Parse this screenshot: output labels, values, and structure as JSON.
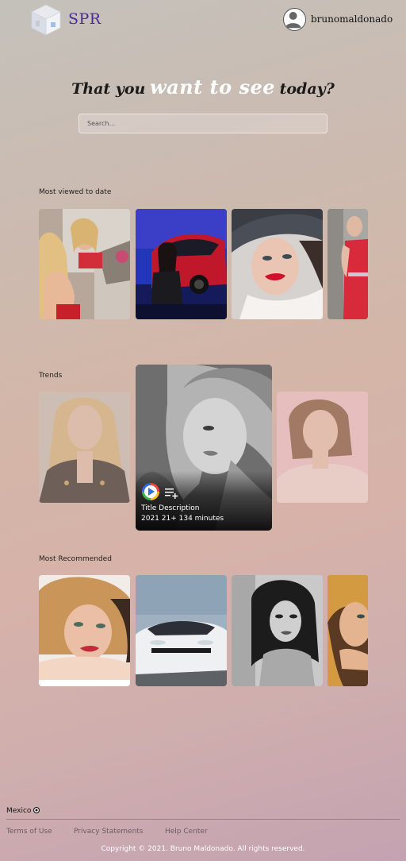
{
  "header": {
    "brand": "SPR",
    "username": "brunomaldonado"
  },
  "hero": {
    "part1": "That you",
    "part2": "want to see",
    "part3": "today?"
  },
  "search": {
    "placeholder": "Search..."
  },
  "sections": {
    "most_viewed": "Most viewed to date",
    "trends": "Trends",
    "most_recommended": "Most Recommended"
  },
  "featured": {
    "title": "Title Description",
    "meta": "2021 21+ 134 minutes",
    "play_icon": "play-icon",
    "list_icon": "add-to-list-icon"
  },
  "footer": {
    "country": "Mexico",
    "links": [
      "Terms of Use",
      "Privacy Statements",
      "Help Center"
    ],
    "copyright": "Copyright © 2021. Bruno Maldonado. All rights reserved."
  },
  "colors": {
    "brand": "#4b2a91",
    "accent_red": "#d4202a"
  }
}
